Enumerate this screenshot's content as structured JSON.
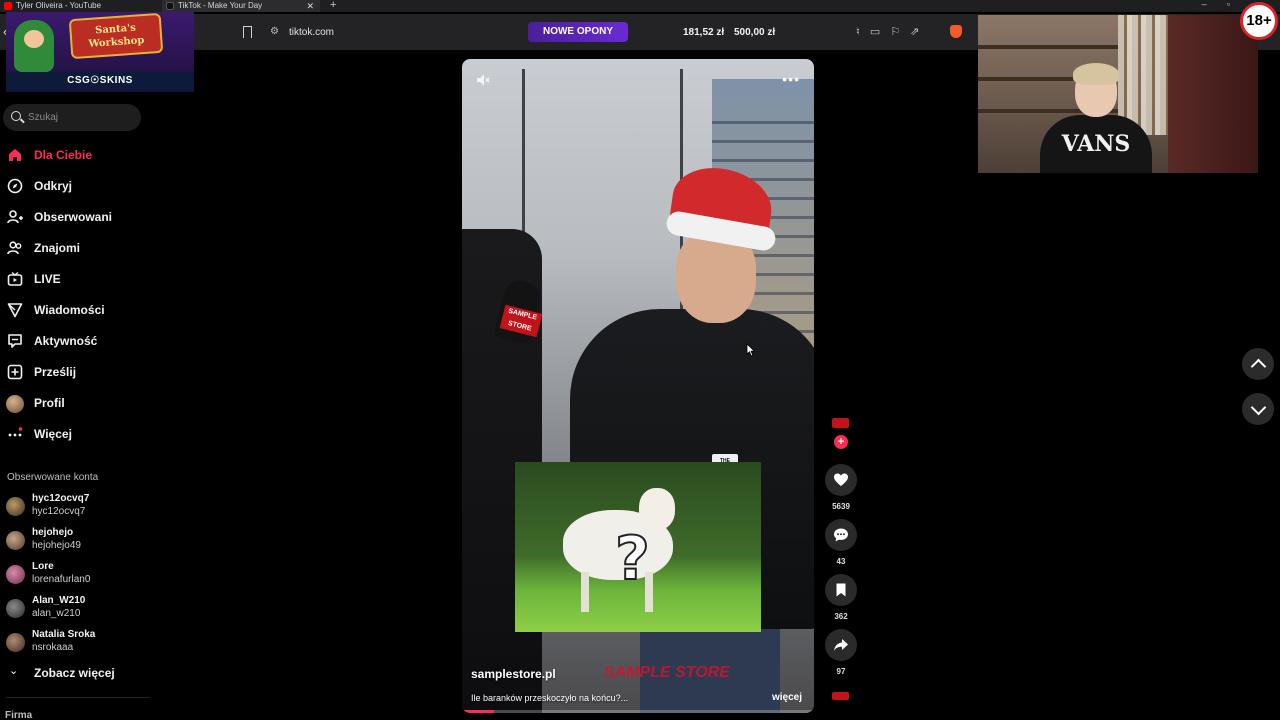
{
  "browser": {
    "tabs": [
      {
        "title": "Tyler Oliveira - YouTube",
        "favicon_color": "#ff0000"
      },
      {
        "title": "TikTok - Make Your Day",
        "favicon_color": "#111111"
      }
    ],
    "url": "tiktok.com",
    "ad_banner": "NOWE OPONY",
    "prices": [
      "181,52 zł",
      "500,00 zł"
    ]
  },
  "overlays": {
    "promo_sign": "Santa's Workshop",
    "promo_label": "CSG☉SKINS",
    "age_badge": "18+",
    "webcam_shirt": "VANS"
  },
  "sidebar": {
    "search_placeholder": "Szukaj",
    "nav": [
      {
        "label": "Dla Ciebie",
        "icon": "home-icon",
        "active": true
      },
      {
        "label": "Odkryj",
        "icon": "compass-icon",
        "active": false
      },
      {
        "label": "Obserwowani",
        "icon": "user-follow-icon",
        "active": false
      },
      {
        "label": "Znajomi",
        "icon": "friends-icon",
        "active": false
      },
      {
        "label": "LIVE",
        "icon": "live-icon",
        "active": false
      },
      {
        "label": "Wiadomości",
        "icon": "send-icon",
        "active": false
      },
      {
        "label": "Aktywność",
        "icon": "activity-icon",
        "active": false
      },
      {
        "label": "Prześlij",
        "icon": "upload-icon",
        "active": false
      },
      {
        "label": "Profil",
        "icon": "profile-avatar",
        "active": false
      },
      {
        "label": "Więcej",
        "icon": "more-icon",
        "active": false
      }
    ],
    "following_title": "Obserwowane konta",
    "following": [
      {
        "name": "hyc12ocvq7",
        "username": "hyc12ocvq7"
      },
      {
        "name": "hejohejo",
        "username": "hejohejo49"
      },
      {
        "name": "Lore",
        "username": "lorenafurlan0"
      },
      {
        "name": "Alan_W210",
        "username": "alan_w210"
      },
      {
        "name": "Natalia Sroka",
        "username": "nsrokaaa"
      }
    ],
    "see_more": "Zobacz więcej",
    "footer_title": "Firma"
  },
  "video": {
    "author": "samplestore.pl",
    "description": "Ile baranków przeskoczyło na końcu?...",
    "more": "więcej",
    "watermark": "SAMPLE STORE",
    "mic_flag": "SAMPLE STORE",
    "jacket_logo": "THE NORTH FACE",
    "overlay_symbol": "?",
    "progress_fraction": 0.09
  },
  "actions": {
    "likes": "5639",
    "comments": "43",
    "saves": "362",
    "shares": "97"
  },
  "colors": {
    "accent": "#fe2c55",
    "background": "#000000",
    "sidebar_text": "#f2f2f2"
  }
}
